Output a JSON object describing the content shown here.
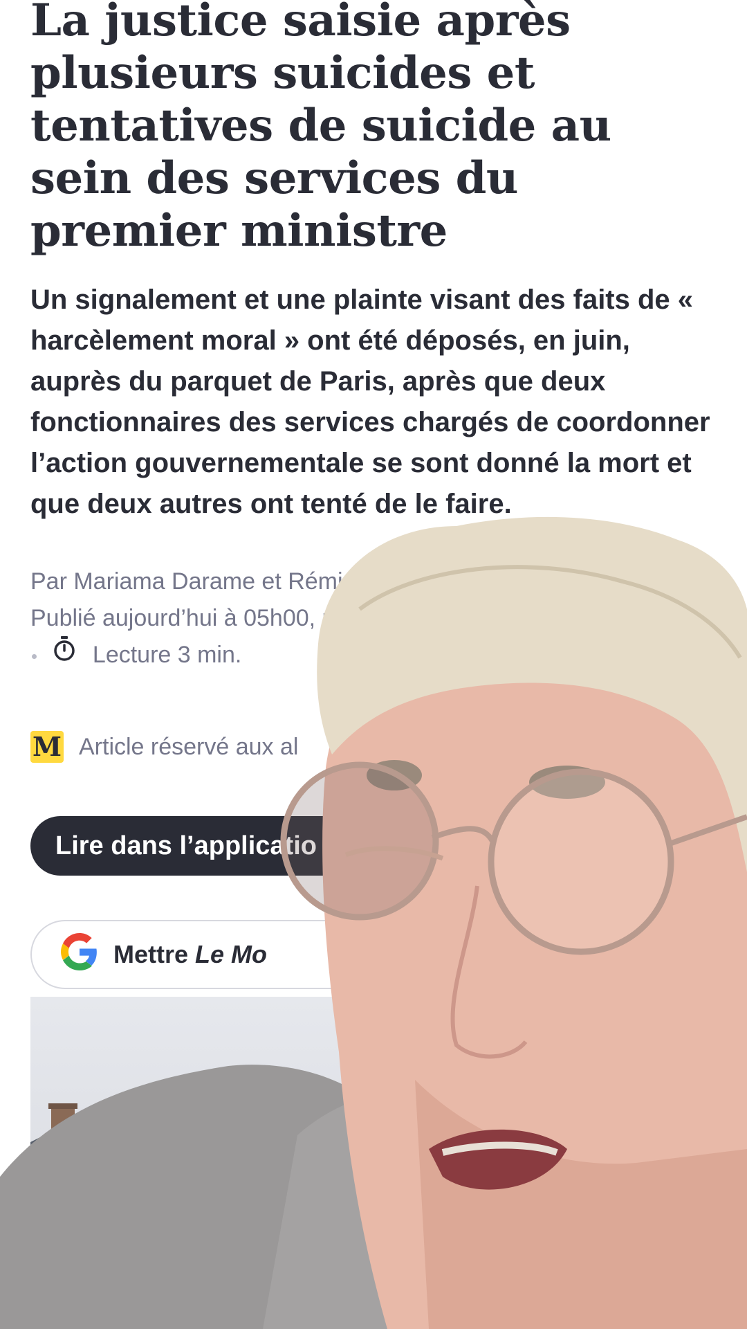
{
  "article": {
    "headline": "La justice saisie après plusieurs suicides et tentatives de suicide au sein des services du premier ministre",
    "lead": "Un signalement et une plainte visant des faits de « harcèlement moral » ont été déposés, en juin, auprès du parquet de Paris, après que deux fonctionnaires des services chargés de coordonner l’action gouvernementale se sont donné la mort et que deux autres ont tenté de le faire.",
    "byline": "Par Mariama Darame et Rémi Dupré",
    "published": "Publié aujourd’hui à 05h00, modifié",
    "reading_time": "Lecture 3 min.",
    "subscriber_label": "Article réservé aux al",
    "logo_letter": "M"
  },
  "buttons": {
    "app_label": "Lire dans l’applicatio",
    "google_prefix": "Mettre",
    "google_brand": "Le Mo"
  },
  "colors": {
    "ink": "#2a2c36",
    "meta": "#74768a",
    "logo_bg": "#ffd93f"
  }
}
